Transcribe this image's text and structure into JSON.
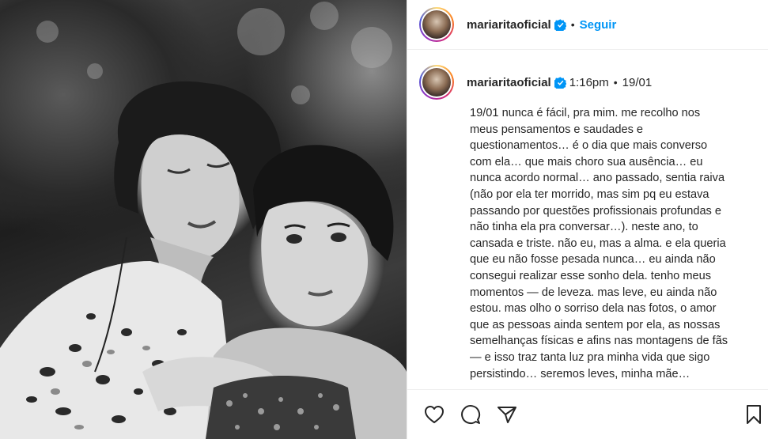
{
  "post": {
    "username": "mariaritaoficial",
    "follow_label": "Seguir",
    "separator": "•",
    "time": "1:16pm",
    "date": "19/01",
    "caption": "19/01 nunca é fácil, pra mim. me recolho nos\nmeus pensamentos e saudades e\nquestionamentos… é o dia que mais converso\ncom ela… que mais choro sua ausência… eu\nnunca acordo normal… ano passado, sentia raiva\n(não por ela ter morrido, mas sim pq eu estava\npassando por questões profissionais profundas e\nnão tinha ela pra conversar…). neste ano, to\ncansada e triste. não eu, mas a alma. e ela queria\nque eu não fosse pesada nunca… eu ainda não\nconsegui realizar esse sonho dela. tenho meus\nmomentos — de leveza. mas leve, eu ainda não\nestou. mas olho o sorriso dela nas fotos, o amor\nque as pessoas ainda sentem por ela, as nossas\nsemelhanças físicas e afins nas montagens de fãs\n— e isso traz tanta luz pra minha vida que sigo\npersistindo… seremos leves, minha mãe…"
  },
  "icons": {
    "verified": "verified-badge-icon",
    "like": "heart-icon",
    "comment": "comment-icon",
    "share": "send-icon",
    "save": "bookmark-icon"
  },
  "colors": {
    "link": "#0095f6",
    "verified": "#0095f6",
    "text": "#262626",
    "border": "#efefef"
  }
}
